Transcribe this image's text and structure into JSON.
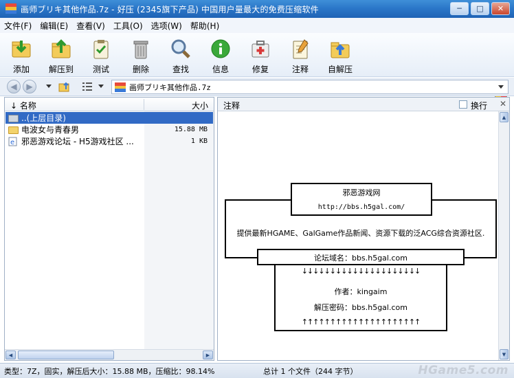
{
  "window": {
    "title": "画师ブリキ其他作品.7z - 好压 (2345旗下产品) 中国用户量最大的免费压缩软件",
    "controls": [
      "minimize",
      "maximize",
      "close"
    ]
  },
  "menu": [
    "文件(F)",
    "编辑(E)",
    "查看(V)",
    "工具(O)",
    "选项(W)",
    "帮助(H)"
  ],
  "toolbar": [
    {
      "label": "添加",
      "icon": "add-icon",
      "color": "#3aa33a"
    },
    {
      "label": "解压到",
      "icon": "extract-folder-icon",
      "color": "#e8b23a"
    },
    {
      "label": "测试",
      "icon": "test-clipboard-icon",
      "color": "#3a9a3a"
    },
    {
      "label": "删除",
      "icon": "trash-icon",
      "color": "#8a8a8a"
    },
    {
      "label": "查找",
      "icon": "magnifier-icon",
      "color": "#4a8ad0"
    },
    {
      "label": "信息",
      "icon": "info-icon",
      "color": "#2e9b2e"
    },
    {
      "label": "修复",
      "icon": "repair-kit-icon",
      "color": "#d04040"
    },
    {
      "label": "注释",
      "icon": "notepad-icon",
      "color": "#c08a30"
    },
    {
      "label": "自解压",
      "icon": "self-extract-icon",
      "color": "#e8a23a"
    }
  ],
  "address": {
    "path": "画师ブリキ其他作品.7z"
  },
  "files": {
    "col_name": "名称",
    "col_size": "大小",
    "rows": [
      {
        "name": "..(上层目录)",
        "size": "",
        "type": "parent",
        "selected": true
      },
      {
        "name": "电波女与青春男",
        "size": "15.88 MB",
        "type": "folder",
        "selected": false
      },
      {
        "name": "邪恶游戏论坛 - H5游戏社区 ...",
        "size": "1 KB",
        "type": "link",
        "selected": false
      }
    ]
  },
  "comment": {
    "title": "注释",
    "wrap_label": "换行",
    "wrap_checked": false,
    "site_name": "邪恶游戏网",
    "site_url": "http://bbs.h5gal.com/",
    "description": "提供最新HGAME、GalGame作品新闻、资源下载的泛ACG综合资源社区.",
    "forum_domain": "论坛域名：bbs.h5gal.com",
    "arrows_down": "↓↓↓↓↓↓↓↓↓↓↓↓↓↓↓↓↓↓↓↓↓",
    "author": "作者：kingaim",
    "password": "解压密码：bbs.h5gal.com",
    "arrows_up": "↑↑↑↑↑↑↑↑↑↑↑↑↑↑↑↑↑↑↑↑↑"
  },
  "status": {
    "left": "类型：7Z，固实，解压后大小：15.88 MB，压缩比：98.14%",
    "right": "总计 1 个文件（244 字节）",
    "watermark": "HGame5.com"
  }
}
